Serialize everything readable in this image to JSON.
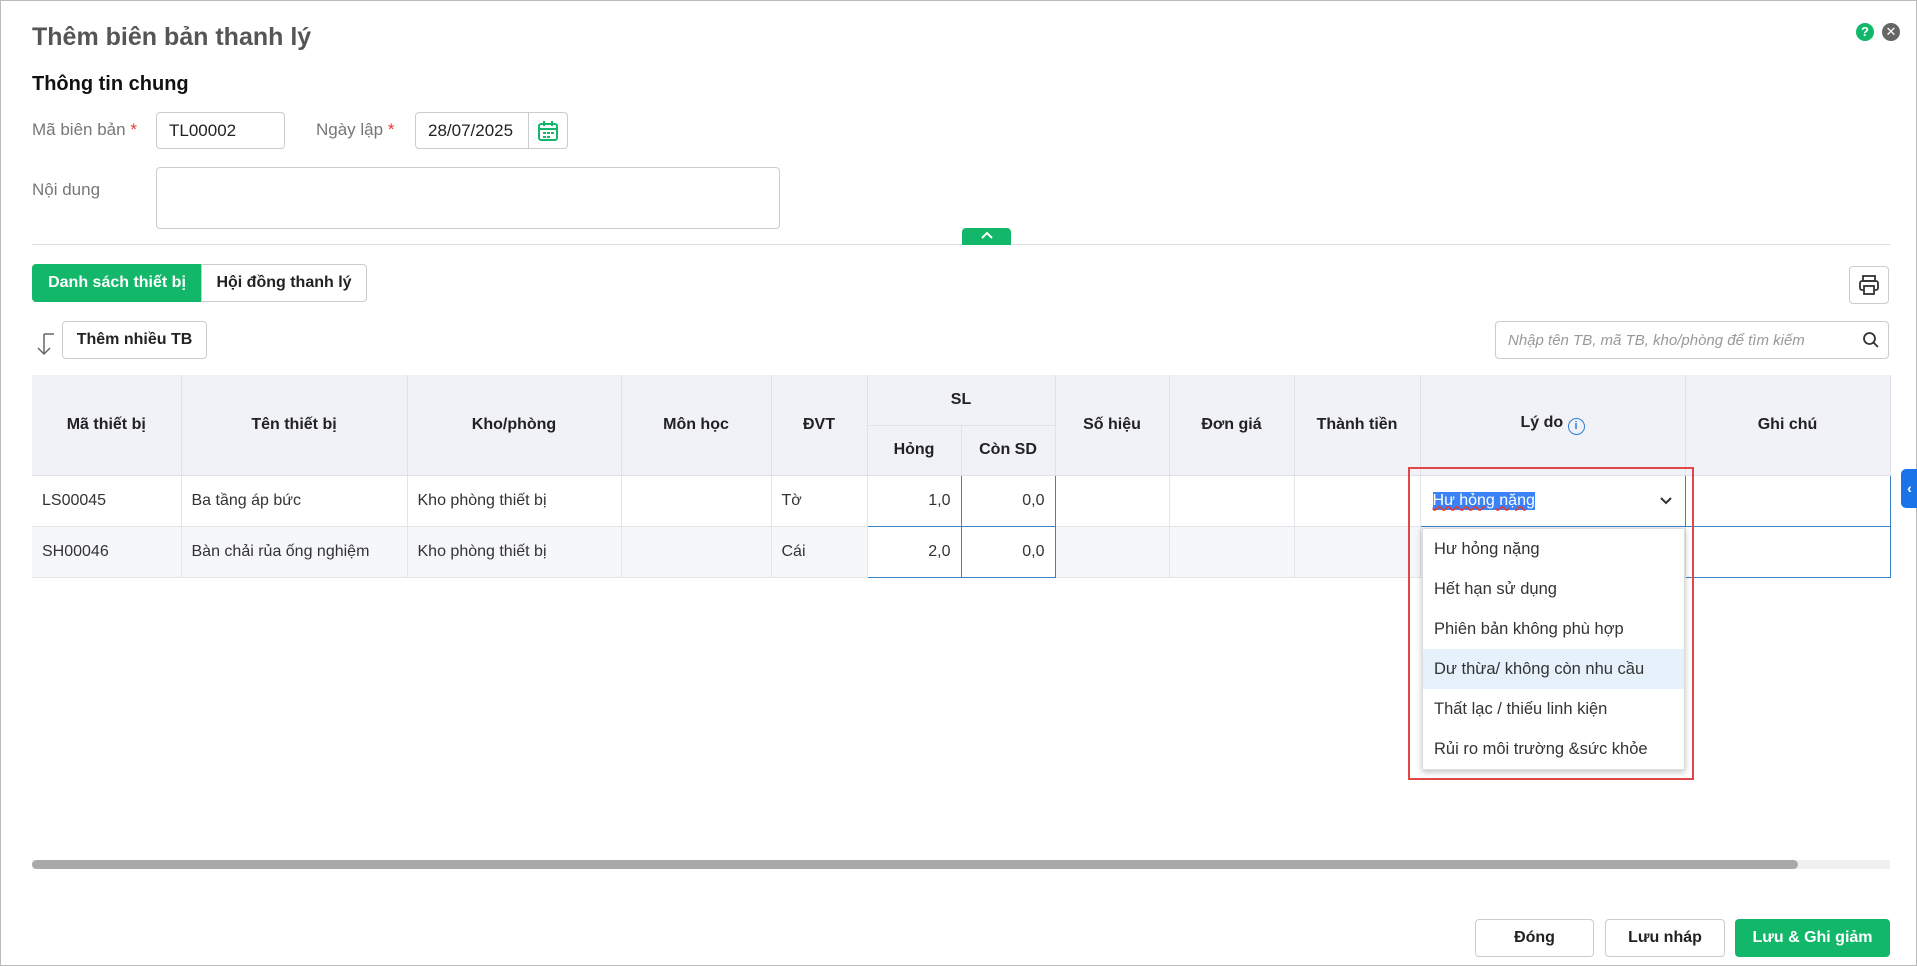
{
  "dialog": {
    "title": "Thêm biên bản thanh lý",
    "section": "Thông tin chung"
  },
  "form": {
    "code_label": "Mã biên bản",
    "code_value": "TL00002",
    "date_label": "Ngày lập",
    "date_value": "28/07/2025",
    "content_label": "Nội dung",
    "required_mark": "*"
  },
  "tabs": [
    {
      "label": "Danh sách thiết bị"
    },
    {
      "label": "Hội đồng thanh lý"
    }
  ],
  "toolbar": {
    "add_many": "Thêm nhiều TB",
    "search_placeholder": "Nhập tên TB, mã TB, kho/phòng để tìm kiếm"
  },
  "table": {
    "headers": {
      "code": "Mã thiết bị",
      "name": "Tên thiết bị",
      "room": "Kho/phòng",
      "subject": "Môn học",
      "unit": "ĐVT",
      "qty": "SL",
      "broken": "Hỏng",
      "remain": "Còn SD",
      "serial": "Số hiệu",
      "price": "Đơn giá",
      "amount": "Thành tiền",
      "reason": "Lý do",
      "note": "Ghi chú"
    },
    "rows": [
      {
        "code": "LS00045",
        "name": "Ba tầng áp bức",
        "room": "Kho phòng thiết bị",
        "subject": "",
        "unit": "Tờ",
        "broken": "1,0",
        "remain": "0,0",
        "reason": "Hư hỏng nặng"
      },
      {
        "code": "SH00046",
        "name": "Bàn chải rủa ống nghiệm",
        "room": "Kho phòng thiết bị",
        "subject": "",
        "unit": "Cái",
        "broken": "2,0",
        "remain": "0,0",
        "reason": ""
      }
    ]
  },
  "reason_options": [
    "Hư hỏng nặng",
    "Hết hạn sử dụng",
    "Phiên bản không phù hợp",
    "Dư thừa/ không còn nhu cầu",
    "Thất lạc / thiếu linh kiện",
    "Rủi ro môi trường &sức khỏe"
  ],
  "footer": {
    "close": "Đóng",
    "draft": "Lưu nháp",
    "save": "Lưu & Ghi giảm"
  },
  "colors": {
    "accent": "#12b76a",
    "focus": "#3b82c4",
    "highlight": "#e53935"
  }
}
